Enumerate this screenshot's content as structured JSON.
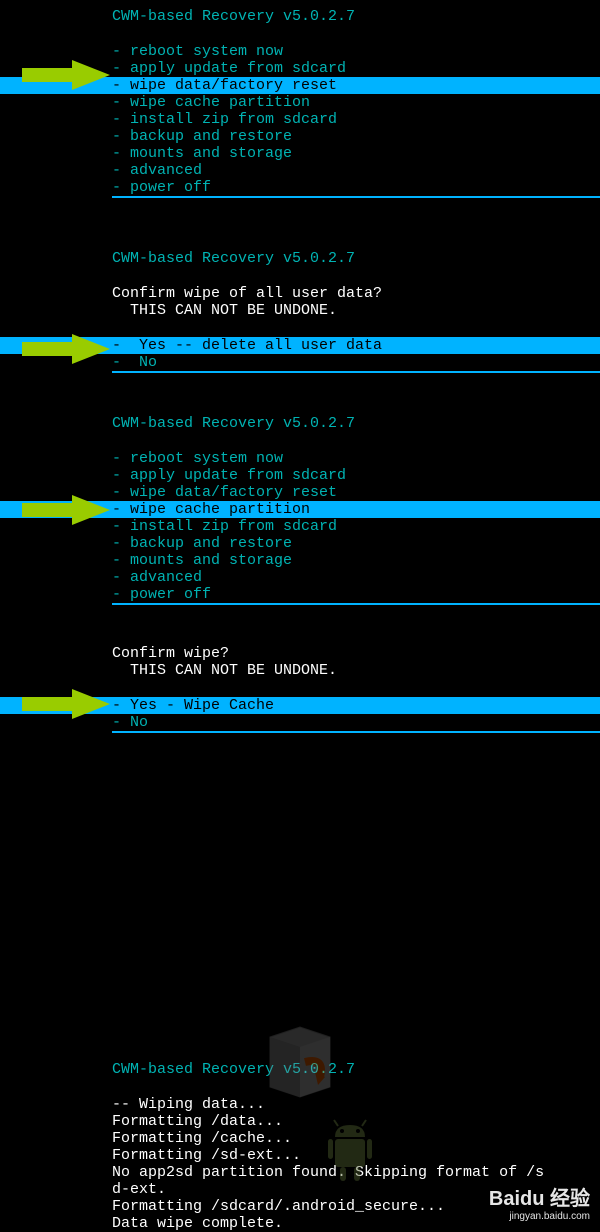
{
  "title": "CWM-based Recovery v5.0.2.7",
  "section1": {
    "items": [
      {
        "label": "reboot system now",
        "selected": false
      },
      {
        "label": "apply update from sdcard",
        "selected": false
      },
      {
        "label": "wipe data/factory reset",
        "selected": true
      },
      {
        "label": "wipe cache partition",
        "selected": false
      },
      {
        "label": "install zip from sdcard",
        "selected": false
      },
      {
        "label": "backup and restore",
        "selected": false
      },
      {
        "label": "mounts and storage",
        "selected": false
      },
      {
        "label": "advanced",
        "selected": false
      },
      {
        "label": "power off",
        "selected": false
      }
    ]
  },
  "section2": {
    "prompt1": "Confirm wipe of all user data?",
    "prompt2": "  THIS CAN NOT BE UNDONE.",
    "items": [
      {
        "label": " Yes -- delete all user data",
        "selected": true
      },
      {
        "label": " No",
        "selected": false
      }
    ]
  },
  "section3": {
    "items": [
      {
        "label": "reboot system now",
        "selected": false
      },
      {
        "label": "apply update from sdcard",
        "selected": false
      },
      {
        "label": "wipe data/factory reset",
        "selected": false
      },
      {
        "label": "wipe cache partition",
        "selected": true
      },
      {
        "label": "install zip from sdcard",
        "selected": false
      },
      {
        "label": "backup and restore",
        "selected": false
      },
      {
        "label": "mounts and storage",
        "selected": false
      },
      {
        "label": "advanced",
        "selected": false
      },
      {
        "label": "power off",
        "selected": false
      }
    ]
  },
  "section4": {
    "prompt1": "Confirm wipe?",
    "prompt2": "  THIS CAN NOT BE UNDONE.",
    "items": [
      {
        "label": "Yes - Wipe Cache",
        "selected": true
      },
      {
        "label": "No",
        "selected": false
      }
    ]
  },
  "section5": {
    "lines": [
      "-- Wiping data...",
      "Formatting /data...",
      "Formatting /cache...",
      "Formatting /sd-ext...",
      "No app2sd partition found. Skipping format of /s",
      "d-ext.",
      "Formatting /sdcard/.android_secure...",
      "Data wipe complete."
    ]
  },
  "watermark": {
    "main": "Baidu 经验",
    "sub": "jingyan.baidu.com"
  }
}
